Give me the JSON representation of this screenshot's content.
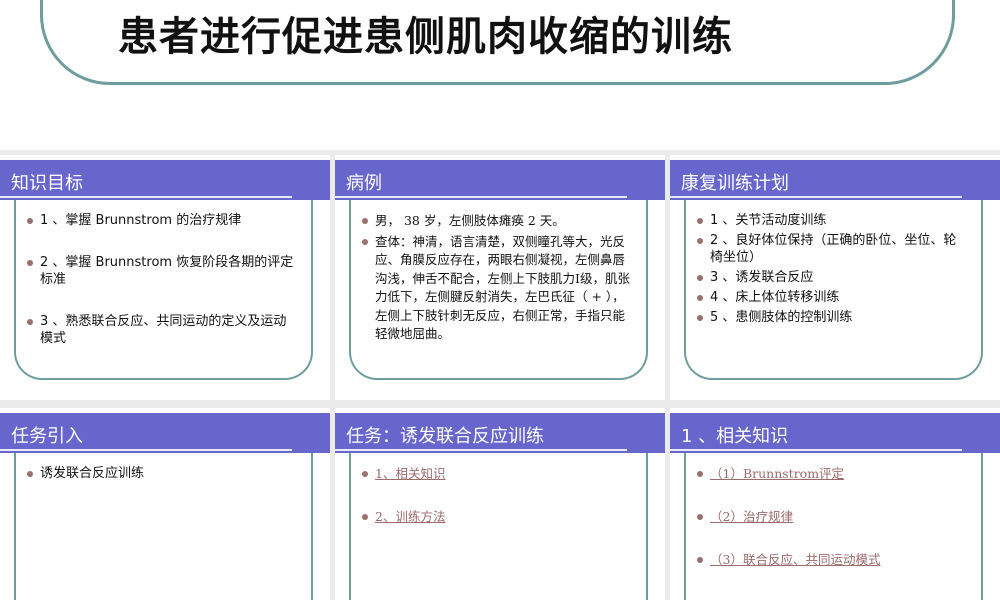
{
  "title": "患者进行促进患侧肌肉收缩的训练",
  "panels": [
    {
      "header": "知识目标",
      "items": [
        "1 、掌握 Brunnstrom 的治疗规律",
        "2 、掌握 Brunnstrom 恢复阶段各期的评定标准",
        "3 、熟悉联合反应、共同运动的定义及运动模式"
      ]
    },
    {
      "header": "病例",
      "items": [
        "男， 38 岁，左侧肢体瘫痪 2 天。",
        "查体：神清，语言清楚，双侧瞳孔等大，光反应、角膜反应存在，两眼右侧凝视，左侧鼻唇沟浅，伸舌不配合，左侧上下肢肌力Ⅰ级，肌张力低下，左侧腱反射消失，左巴氏征（ + ），左侧上下肢针刺无反应，右侧正常，手指只能轻微地屈曲。"
      ]
    },
    {
      "header": "康复训练计划",
      "items": [
        "1 、关节活动度训练",
        "2 、良好体位保持（正确的卧位、坐位、轮椅坐位）",
        "3 、诱发联合反应",
        "4 、床上体位转移训练",
        "5 、患侧肢体的控制训练"
      ]
    },
    {
      "header": "任务引入",
      "items": [
        "诱发联合反应训练"
      ]
    },
    {
      "header": "任务：诱发联合反应训练",
      "items": [
        "1、相关知识",
        "2、训练方法"
      ]
    },
    {
      "header": "1 、相关知识",
      "items": [
        "（1）Brunnstrom评定",
        "（2）治疗规律",
        "（3）联合反应、共同运动模式"
      ]
    }
  ]
}
